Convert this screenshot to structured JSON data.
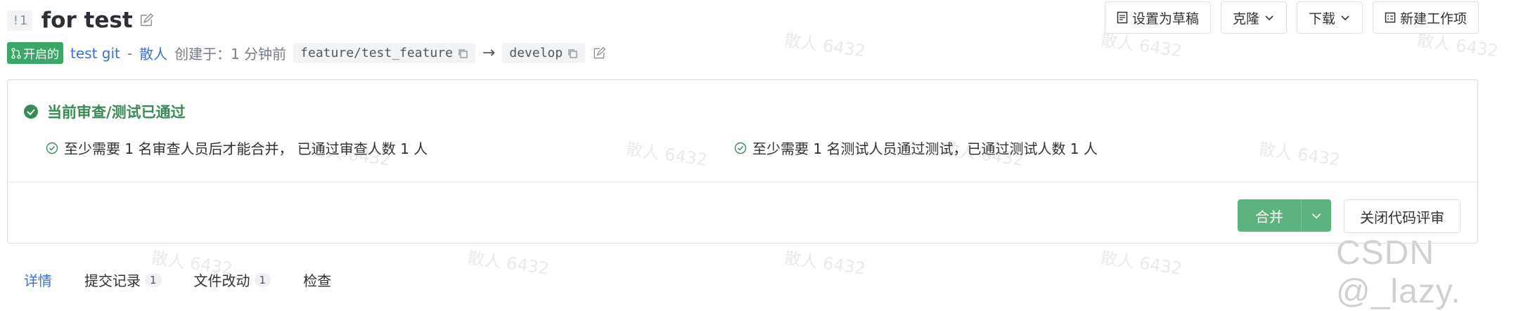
{
  "watermark": {
    "text": "散人 6432",
    "csdn": "CSDN @_lazy."
  },
  "header": {
    "pr_number": "!1",
    "title": "for test"
  },
  "actions": {
    "draft": "设置为草稿",
    "clone": "克隆",
    "download": "下载",
    "new_work_item": "新建工作项"
  },
  "meta": {
    "status": "开启的",
    "repo": "test git",
    "separator": "-",
    "author": "散人",
    "created": "创建于：1 分钟前",
    "source_branch": "feature/test_feature",
    "arrow": "→",
    "target_branch": "develop"
  },
  "review": {
    "status_title": "当前审查/测试已通过",
    "review_condition": "至少需要 1 名审查人员后才能合并， 已通过审查人数 1 人",
    "test_condition": "至少需要 1 名测试人员通过测试，已通过测试人数 1 人"
  },
  "buttons": {
    "merge": "合并",
    "close": "关闭代码评审"
  },
  "tabs": [
    {
      "label": "详情"
    },
    {
      "label": "提交记录",
      "count": "1"
    },
    {
      "label": "文件改动",
      "count": "1"
    },
    {
      "label": "检查"
    }
  ],
  "colors": {
    "accent": "#3f6fd4",
    "success": "#3aa667",
    "merge": "#5cb37e"
  }
}
